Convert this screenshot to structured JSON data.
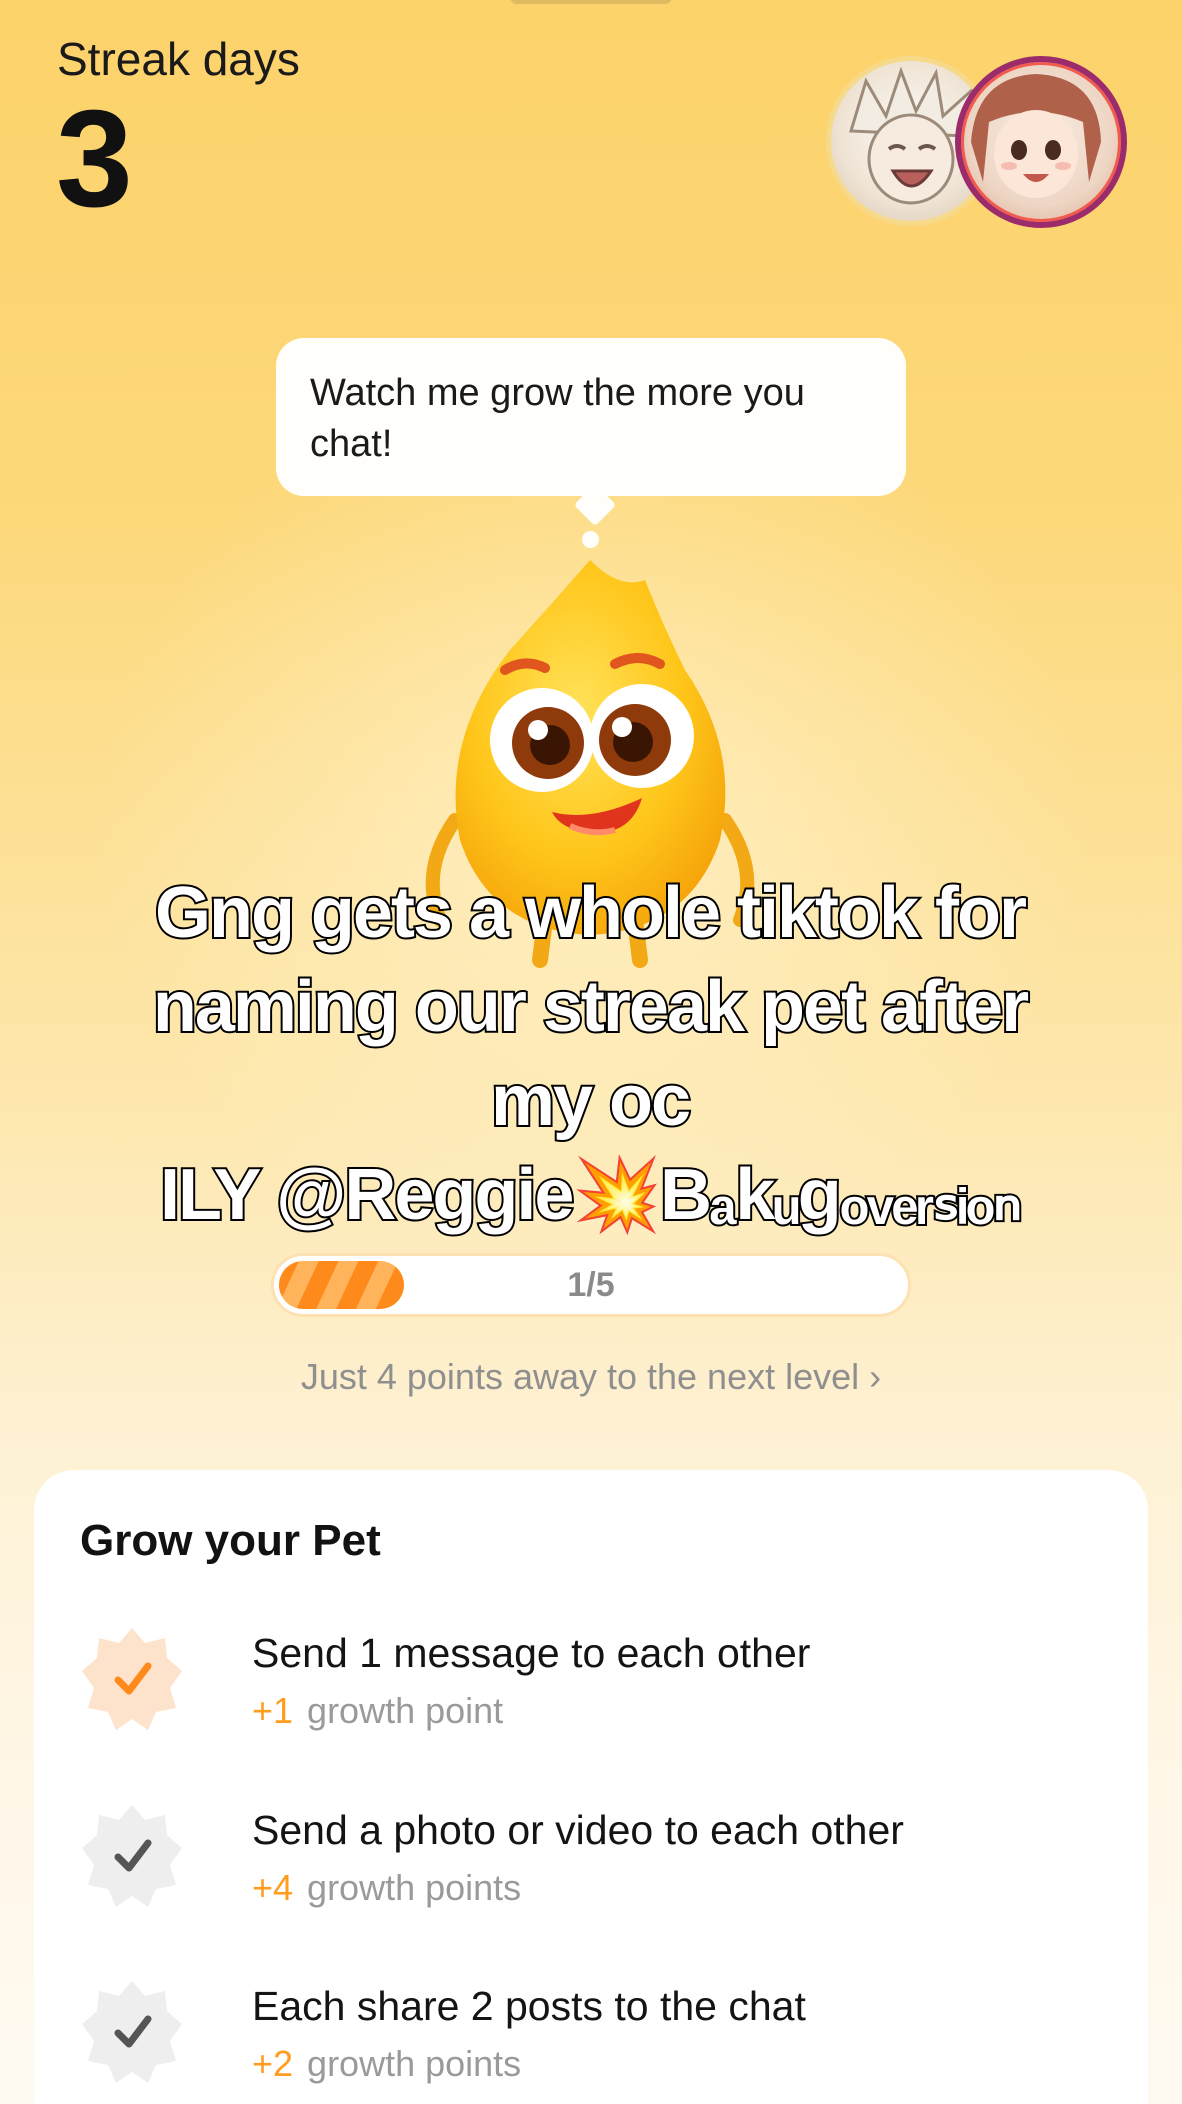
{
  "header": {
    "streak_label": "Streak days",
    "streak_count": "3"
  },
  "pet": {
    "speech": "Watch me grow the more you chat!"
  },
  "caption": {
    "lines": [
      "Gng gets a whole tiktok for",
      "naming our streak pet after",
      "my oc",
      "ILY @Reggie💥Bₐkᵤgₒᵥₑᵣₛᵢₒₙ"
    ]
  },
  "progress": {
    "label": "1/5",
    "current": 1,
    "total": 5,
    "fraction": 0.2,
    "next_level_text": "Just 4 points away to the next level",
    "chevron": "›"
  },
  "grow": {
    "title": "Grow your Pet",
    "tasks": [
      {
        "title": "Send 1 message to each other",
        "points": "+1",
        "points_label": "growth point",
        "done": true
      },
      {
        "title": "Send a photo or video to each other",
        "points": "+4",
        "points_label": "growth points",
        "done": false
      },
      {
        "title": "Each share 2 posts to the chat",
        "points": "+2",
        "points_label": "growth points",
        "done": false
      }
    ]
  },
  "colors": {
    "accent": "#ff9d1f",
    "done_badge": "#fde3cb",
    "done_check": "#ff8a1c",
    "pending_badge": "#eeeeee",
    "pending_check": "#555555"
  },
  "icons": {
    "done": "check-badge-icon",
    "pending": "check-badge-icon",
    "chevron": "chevron-right-icon"
  }
}
